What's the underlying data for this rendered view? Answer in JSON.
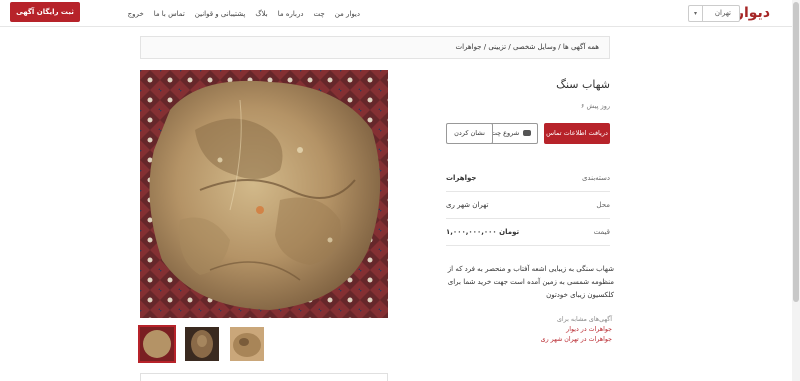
{
  "header": {
    "logo": "دیوار",
    "city": "تهران",
    "nav": [
      "دیوار من",
      "چت",
      "درباره ما",
      "بلاگ",
      "پشتیبانی و قوانین",
      "تماس با ما",
      "خروج"
    ],
    "post_button": "ثبت رایگان آگهی"
  },
  "breadcrumb": "همه آگهی ها / وسایل شخصی / تزیینی / جواهرات",
  "listing": {
    "title": "شهاب سنگ",
    "time": "۶ روز پیش",
    "contact_button": "دریافت اطلاعات تماس",
    "chat_button": "شروع چت",
    "mark_button": "نشان کردن",
    "details": [
      {
        "key": "دسته‌بندی",
        "value": "جواهرات"
      },
      {
        "key": "محل",
        "value": "تهران شهر ری"
      },
      {
        "key": "قیمت",
        "value": "۱,۰۰۰,۰۰۰,۰۰۰ تومان"
      }
    ],
    "description": "شهاب سنگی به زیبایی اشعه آفتاب و منحصر به فرد که از منظومه شمسی به زمین آمده است جهت خرید شما برای کلکسیون زیبای خودتون",
    "related_heading": "آگهی‌های مشابه برای",
    "related_links": [
      "جواهرات در دیوار",
      "جواهرات در تهران شهر ری"
    ]
  },
  "colors": {
    "brand": "#b7232a",
    "carpet": "#7a1f22",
    "stone": "#b89a6a"
  },
  "icons": {
    "chat": "chat-icon",
    "caret": "caret-down-icon"
  }
}
